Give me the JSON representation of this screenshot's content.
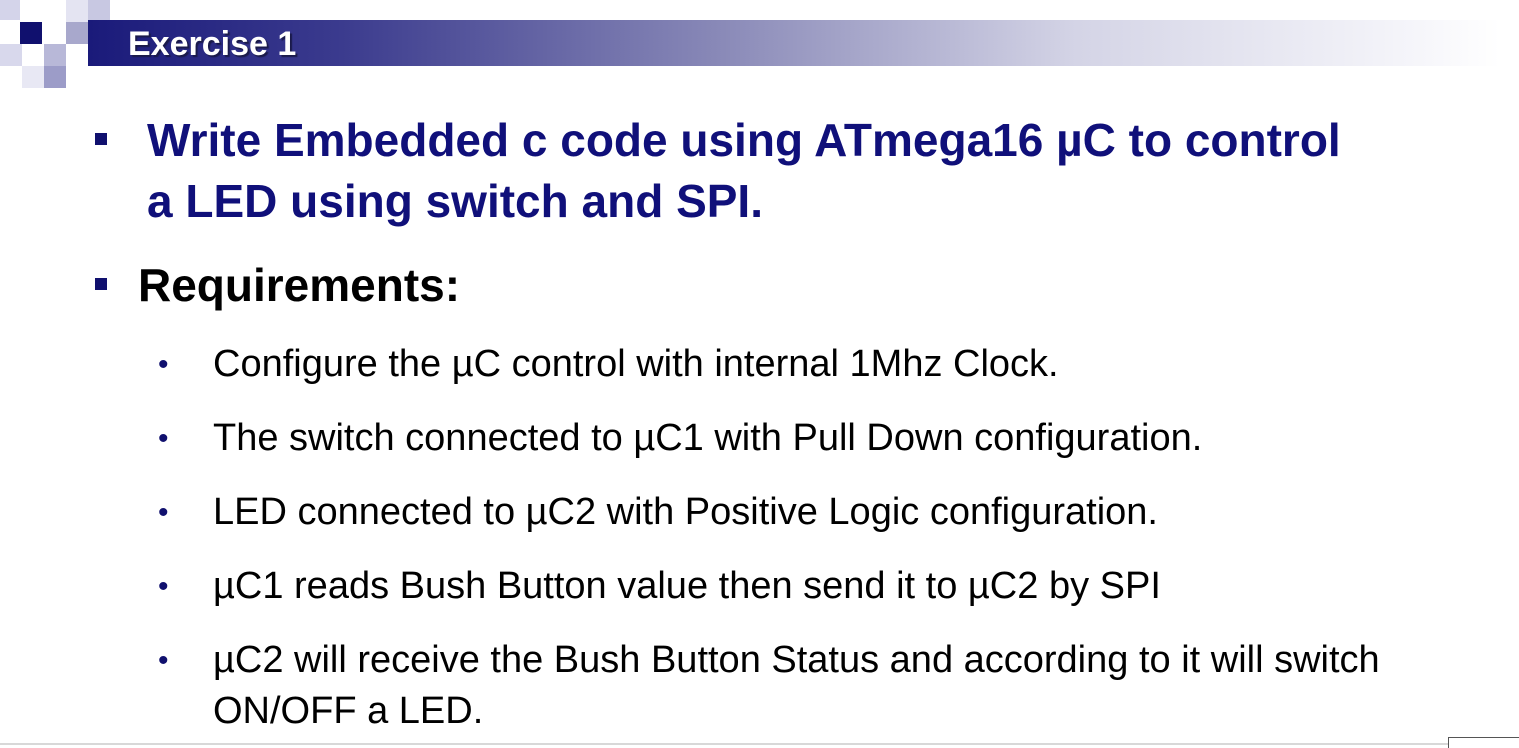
{
  "slide": {
    "title": "Exercise 1",
    "colors": {
      "title_bar_dark": "#1a1a7a",
      "heading_blue": "#10107a",
      "bullet_blue": "#10106e"
    },
    "bullets": [
      {
        "text": "Write Embedded c code using ATmega16 µC to control a LED using switch and SPI."
      },
      {
        "text": "Requirements:",
        "sub_items": [
          "Configure the µC control with internal 1Mhz Clock.",
          "The switch connected to µC1 with Pull Down configuration.",
          "LED connected to µC2 with Positive Logic configuration.",
          "µC1 reads Bush Button value then send it to µC2 by SPI",
          "µC2 will receive the Bush Button Status and according to it will switch ON/OFF a LED."
        ]
      }
    ],
    "sub_bullet_glyph": "•"
  }
}
